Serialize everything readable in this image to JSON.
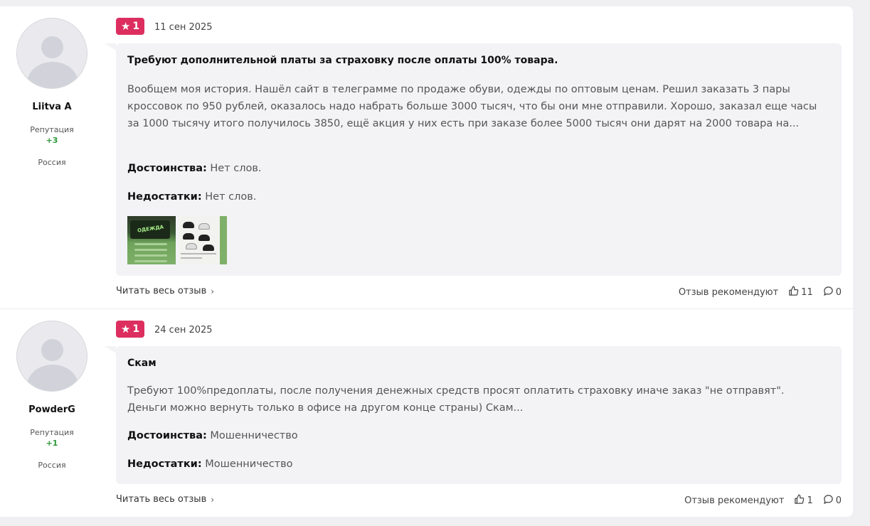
{
  "reviews": [
    {
      "author": {
        "name": "Liitva A",
        "reputation_label": "Репутация",
        "reputation_value": "+3",
        "country": "Россия"
      },
      "rating": "1",
      "date": "11 сен 2025",
      "title": "Требуют дополнительной платы за страховку после оплаты 100% товара.",
      "text": "Вообщем моя история. Нашёл сайт в телеграмме по продаже обуви, одежды по оптовым ценам. Решил заказать 3 пары кроссовок по 950 рублей, оказалось надо набрать больше 3000 тысяч, что бы они мне отправили. Хорошо, заказал еще часы за 1000 тысячу итого получилось 3850, ещё акция у них есть при заказе более 5000 тысяч они дарят на 2000 товара на...",
      "pros_label": "Достоинства:",
      "pros": "Нет слов.",
      "cons_label": "Недостатки:",
      "cons": "Нет слов.",
      "image_texts": [
        "ОДЕЖДА"
      ],
      "read_more": "Читать весь отзыв",
      "recommend_label": "Отзыв рекомендуют",
      "likes": "11",
      "comments": "0"
    },
    {
      "author": {
        "name": "PowderG",
        "reputation_label": "Репутация",
        "reputation_value": "+1",
        "country": "Россия"
      },
      "rating": "1",
      "date": "24 сен 2025",
      "title": "Скам",
      "text": "Требуют 100%предоплаты, после получения денежных средств просят оплатить страховку иначе заказ \"не отправят\". Деньги можно вернуть только в офисе на другом конце страны) Скам...",
      "pros_label": "Достоинства:",
      "pros": "Мошенничество",
      "cons_label": "Недостатки:",
      "cons": "Мошенничество",
      "read_more": "Читать весь отзыв",
      "recommend_label": "Отзыв рекомендуют",
      "likes": "1",
      "comments": "0"
    }
  ],
  "colors": {
    "rating_badge": "#dc2f5f",
    "reputation_positive": "#2e9a3a",
    "bubble_bg": "#f3f3f6"
  },
  "icons": {
    "rating": "star-icon",
    "like": "thumbs-up-icon",
    "comment": "comment-icon",
    "read_more": "chevron-right-icon"
  }
}
